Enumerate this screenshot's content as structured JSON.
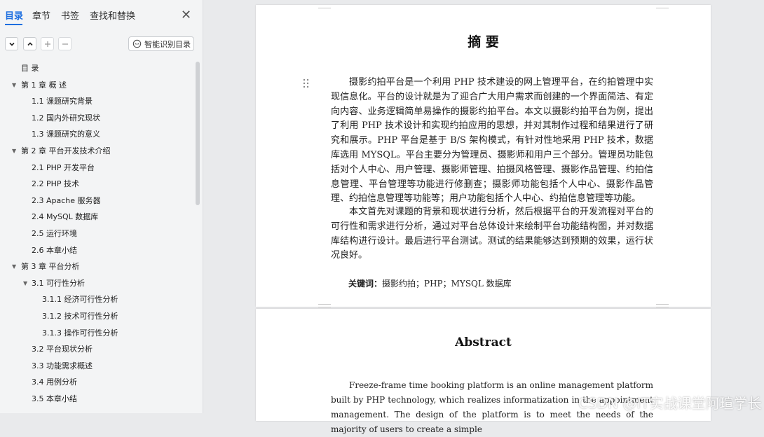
{
  "nav": {
    "tabs": [
      "目录",
      "章节",
      "书签",
      "查找和替换"
    ],
    "smart_toc_label": "智能识别目录",
    "toc": [
      {
        "label": "目  录",
        "level": 0,
        "expandable": false
      },
      {
        "label": "第 1 章   概   述",
        "level": 0,
        "expandable": true
      },
      {
        "label": "1.1   课题研究背景",
        "level": 1,
        "expandable": false
      },
      {
        "label": "1.2   国内外研究现状",
        "level": 1,
        "expandable": false
      },
      {
        "label": "1.3   课题研究的意义",
        "level": 1,
        "expandable": false
      },
      {
        "label": "第 2 章   平台开发技术介绍",
        "level": 0,
        "expandable": true
      },
      {
        "label": "2.1   PHP 开发平台",
        "level": 1,
        "expandable": false
      },
      {
        "label": "2.2   PHP 技术",
        "level": 1,
        "expandable": false
      },
      {
        "label": "2.3   Apache 服务器",
        "level": 1,
        "expandable": false
      },
      {
        "label": "2.4   MySQL 数据库",
        "level": 1,
        "expandable": false
      },
      {
        "label": "2.5   运行环境",
        "level": 1,
        "expandable": false
      },
      {
        "label": "2.6   本章小结",
        "level": 1,
        "expandable": false
      },
      {
        "label": "第 3 章   平台分析",
        "level": 0,
        "expandable": true
      },
      {
        "label": "3.1   可行性分析",
        "level": 1,
        "expandable": true
      },
      {
        "label": "3.1.1   经济可行性分析",
        "level": 2,
        "expandable": false
      },
      {
        "label": "3.1.2   技术可行性分析",
        "level": 2,
        "expandable": false
      },
      {
        "label": "3.1.3   操作可行性分析",
        "level": 2,
        "expandable": false
      },
      {
        "label": "3.2   平台现状分析",
        "level": 1,
        "expandable": false
      },
      {
        "label": "3.3   功能需求概述",
        "level": 1,
        "expandable": false
      },
      {
        "label": "3.4   用例分析",
        "level": 1,
        "expandable": false
      },
      {
        "label": "3.5   本章小结",
        "level": 1,
        "expandable": false
      }
    ]
  },
  "document": {
    "page1": {
      "title": "摘   要",
      "para1": "摄影约拍平台是一个利用 PHP 技术建设的网上管理平台，在约拍管理中实现信息化。平台的设计就是为了迎合广大用户需求而创建的一个界面简洁、有定向内容、业务逻辑简单易操作的摄影约拍平台。本文以摄影约拍平台为例，提出了利用 PHP 技术设计和实现约拍应用的思想，并对其制作过程和结果进行了研究和展示。PHP 平台是基于 B/S 架构模式，有针对性地采用 PHP 技术，数据库选用 MYSQL。平台主要分为管理员、摄影师和用户三个部分。管理员功能包括对个人中心、用户管理、摄影师管理、拍摄风格管理、摄影作品管理、约拍信息管理、平台管理等功能进行修删查；摄影师功能包括个人中心、摄影作品管理、约拍信息管理等功能等；用户功能包括个人中心、约拍信息管理等功能。",
      "para2": "本文首先对课题的背景和现状进行分析，然后根据平台的开发流程对平台的可行性和需求进行分析，通过对平台总体设计来绘制平台功能结构图，并对数据库结构进行设计。最后进行平台测试。测试的结果能够达到预期的效果，运行状况良好。",
      "keywords_label": "关键词：",
      "keywords": "摄影约拍；PHP；MYSQL 数据库"
    },
    "page2": {
      "title": "Abstract",
      "para1": "Freeze-frame time booking platform is an online management platform built by PHP technology, which realizes informatization in the appointment management. The design of the platform is to meet the needs of the majority of users to create a simple"
    }
  },
  "watermark": "CSDN @IT实战课堂阿瑄学长"
}
